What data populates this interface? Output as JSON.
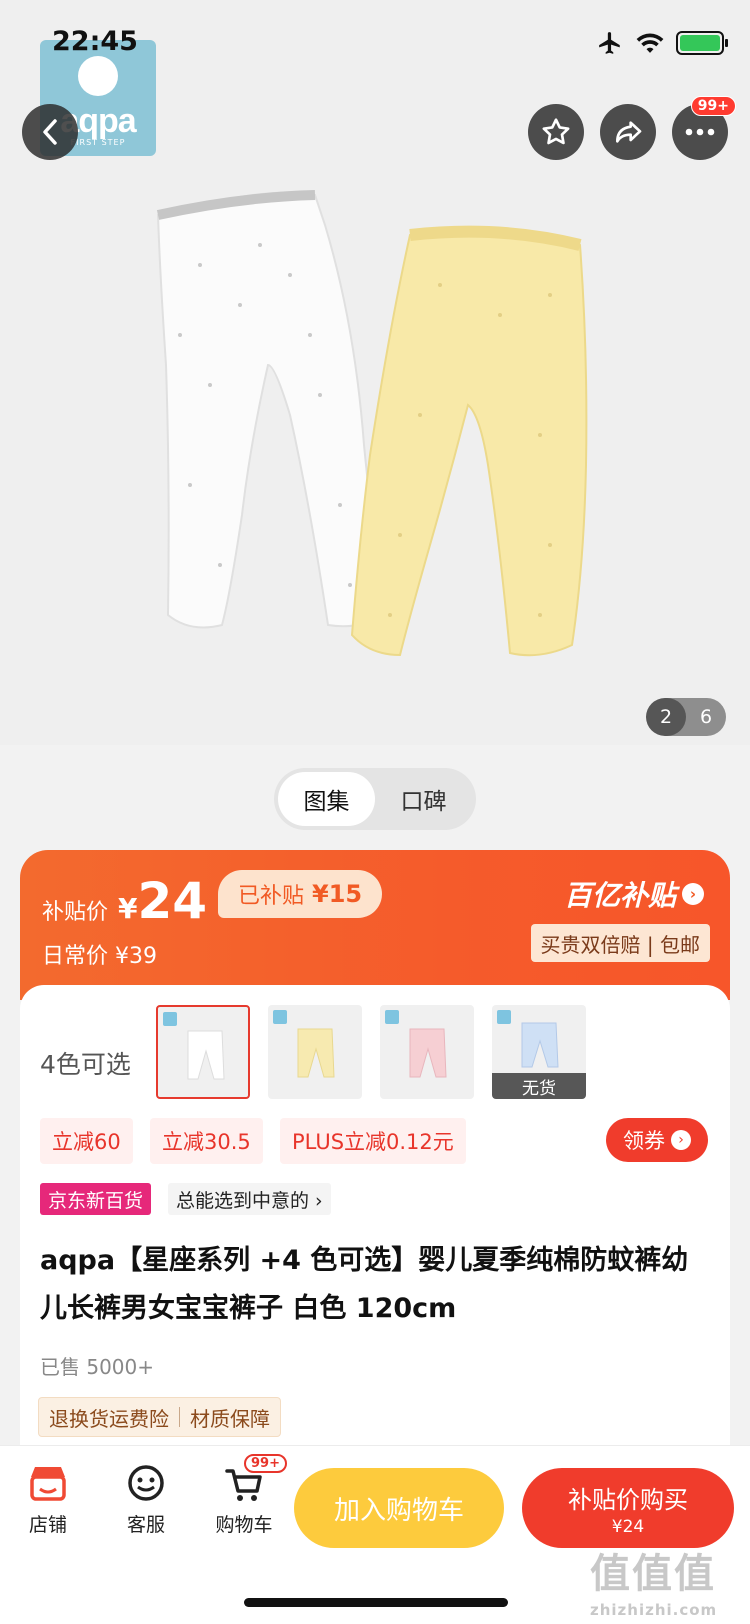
{
  "status_bar": {
    "time": "22:45"
  },
  "brand_logo": {
    "text": "aqpa",
    "sub": "FIRST STEP"
  },
  "header": {
    "more_badge": "99+"
  },
  "gallery": {
    "current_page": "2",
    "total_pages": "6"
  },
  "view_switch": {
    "tabs": [
      {
        "label": "图集"
      },
      {
        "label": "口碑"
      }
    ]
  },
  "price_banner": {
    "subsidy_label": "补贴价",
    "subsidy_price_symbol": "¥",
    "subsidy_price": "24",
    "subsidized_text": "已补贴",
    "subsidized_amount": "¥15",
    "daily_price_label": "日常价 ¥39",
    "program_name": "百亿补贴",
    "guarantee": "买贵双倍赔 | 包邮"
  },
  "variants": {
    "label": "4色可选",
    "sold_out_text": "无货",
    "colors_hex": [
      "#ffffff",
      "#f7eab0",
      "#f6cfd3",
      "#cfe0f5"
    ]
  },
  "coupons": {
    "items": [
      "立减60",
      "立减30.5",
      "PLUS立减0.12元"
    ],
    "claim_label": "领券"
  },
  "store_tag": {
    "badge": "京东新百货",
    "slogan": "总能选到中意的 ›"
  },
  "product": {
    "title": "aqpa【星座系列 +4 色可选】婴儿夏季纯棉防蚊裤幼儿长裤男女宝宝裤子 白色 120cm",
    "sold": "已售 5000+",
    "services": [
      "退换货运费险",
      "材质保障"
    ]
  },
  "bottom_bar": {
    "store": "店铺",
    "service": "客服",
    "cart": "购物车",
    "cart_badge": "99+",
    "add_to_cart": "加入购物车",
    "buy_label": "补贴价购买",
    "buy_price": "¥24"
  },
  "watermark": {
    "text": "值值值",
    "url": "zhizhizhi.com"
  },
  "theme": {
    "accent": "#f03c2c",
    "banner": "#f55b2b",
    "cart_button": "#fdcb3d"
  }
}
